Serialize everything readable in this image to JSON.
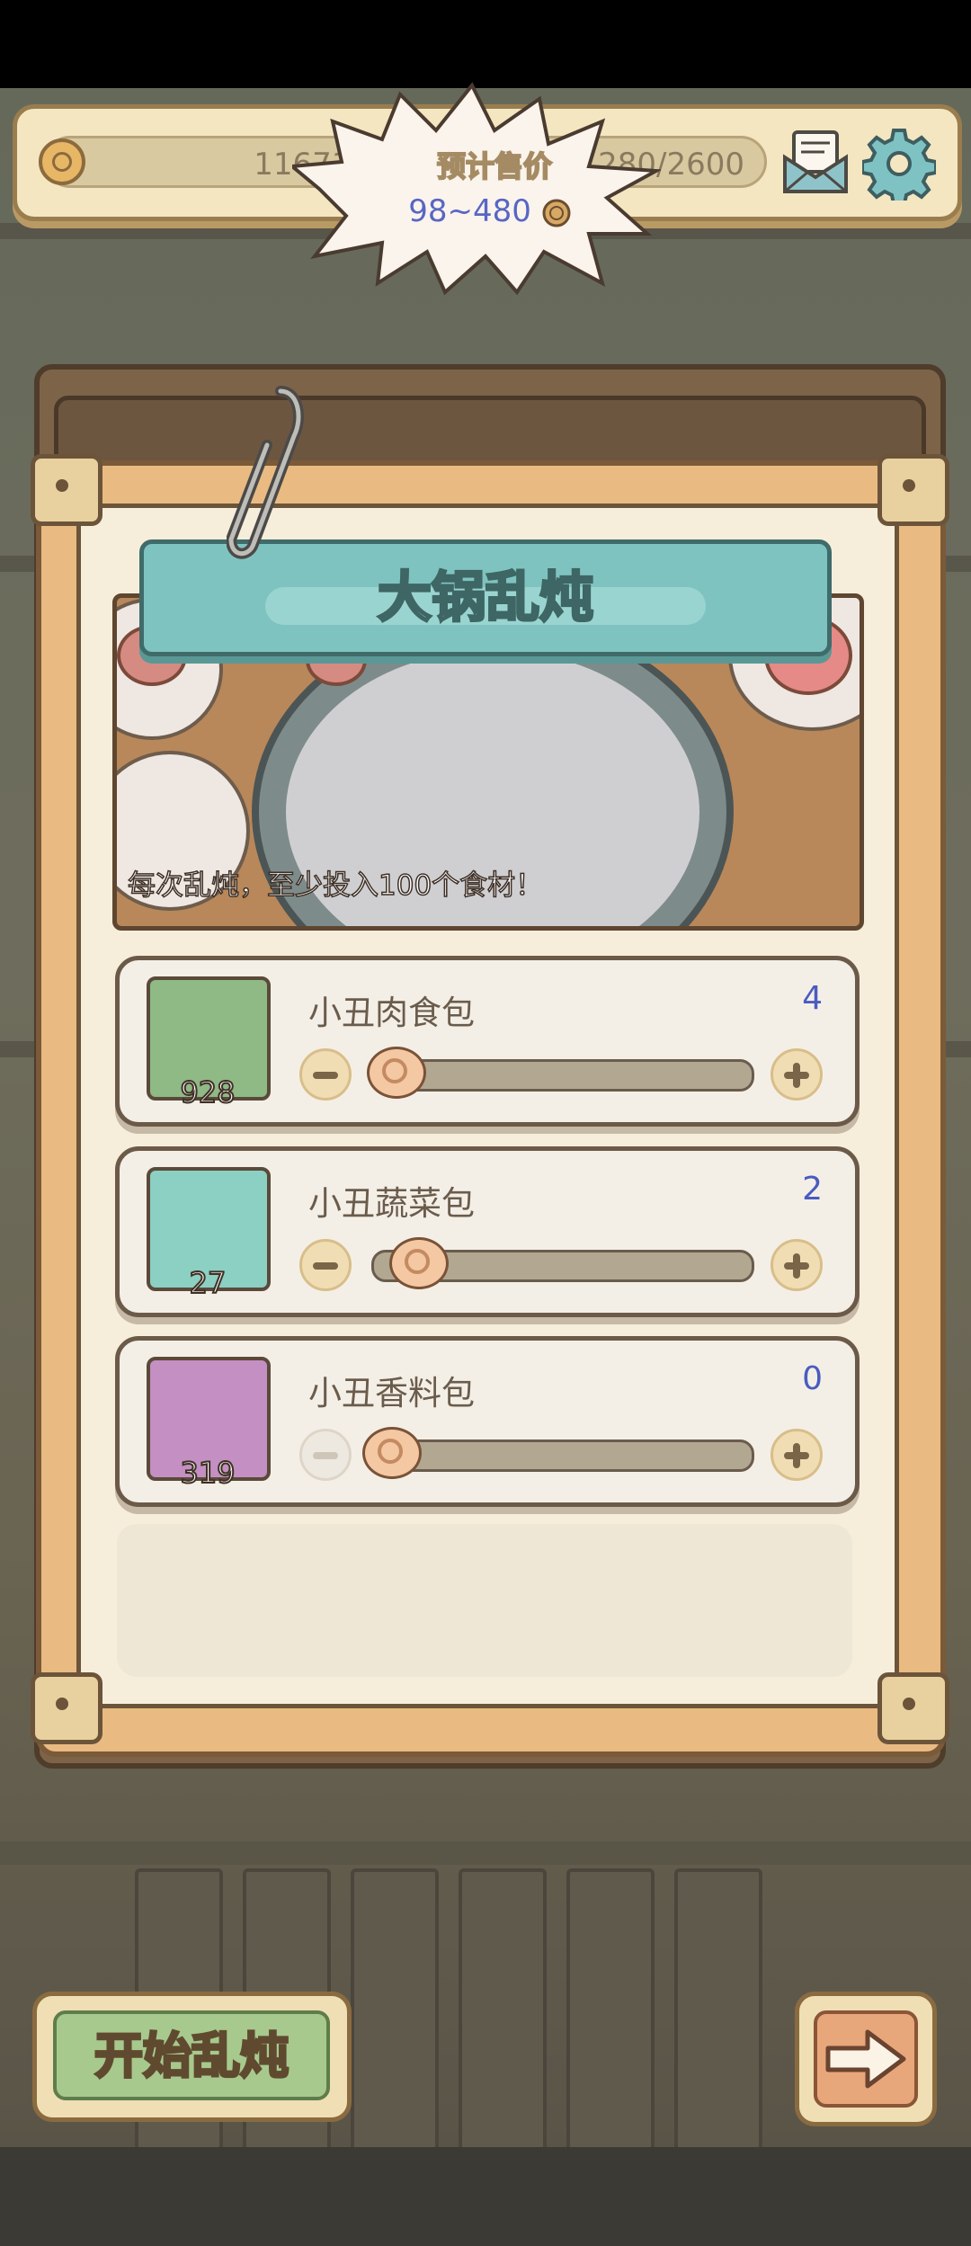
{
  "header": {
    "coins": "116710",
    "fullness": "1280/2600",
    "icons": [
      "coin-icon",
      "fullness-bowl-icon",
      "mail-icon",
      "gear-icon"
    ]
  },
  "dialog": {
    "title": "大锅乱炖",
    "estimated_price_label": "预计售价",
    "estimated_price_value": "98~480",
    "note": "每次乱炖，至少投入100个食材！"
  },
  "ingredients": [
    {
      "name": "小丑肉食包",
      "selected": "4",
      "owned": "928",
      "thumb_color": "#8fb985"
    },
    {
      "name": "小丑蔬菜包",
      "selected": "2",
      "owned": "27",
      "thumb_color": "#8ccfc3"
    },
    {
      "name": "小丑香料包",
      "selected": "0",
      "owned": "319",
      "thumb_color": "#c48fc2"
    }
  ],
  "footer": {
    "start_label": "开始乱炖",
    "next_icon": "arrow-right-icon"
  }
}
